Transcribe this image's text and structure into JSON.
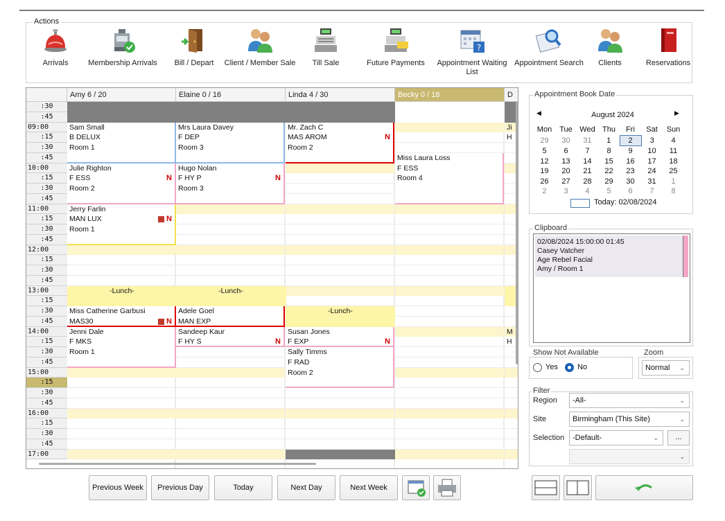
{
  "actions": {
    "legend": "Actions",
    "items": [
      {
        "label": "Arrivals",
        "icon": "bell-icon"
      },
      {
        "label": "Membership Arrivals",
        "icon": "membership-register-icon"
      },
      {
        "label": "Bill / Depart",
        "icon": "door-icon"
      },
      {
        "label": "Client / Member Sale",
        "icon": "clients-icon"
      },
      {
        "label": "Till Sale",
        "icon": "till-icon"
      },
      {
        "label": "Future Payments",
        "icon": "till-card-icon"
      },
      {
        "label": "Appointment Waiting\nList",
        "icon": "calendar-help-icon"
      },
      {
        "label": "Appointment Search",
        "icon": "calendar-search-icon"
      },
      {
        "label": "Clients",
        "icon": "clients-icon"
      },
      {
        "label": "Reservations",
        "icon": "book-icon"
      }
    ]
  },
  "grid": {
    "columns": [
      "Amy 6 / 20",
      "Elaine 0 / 16",
      "Linda 4 / 30",
      "Becky 0 / 18",
      "D"
    ],
    "times": [
      ":30",
      ":45",
      "09:00",
      ":15",
      ":30",
      ":45",
      "10:00",
      ":15",
      ":30",
      ":45",
      "11:00",
      ":15",
      ":30",
      ":45",
      "12:00",
      ":15",
      ":30",
      ":45",
      "13:00",
      ":15",
      ":30",
      ":45",
      "14:00",
      ":15",
      ":30",
      ":45",
      "15:00",
      ":15",
      ":30",
      ":45",
      "16:00",
      ":15",
      ":30",
      ":45",
      "17:00"
    ],
    "current_slot": ":15",
    "appointments": [
      {
        "lines": [
          "Sam Small",
          "B DELUX",
          "Room 1"
        ]
      },
      {
        "lines": [
          "Mrs Laura Davey",
          "F DEP",
          "Room 3"
        ]
      },
      {
        "lines": [
          "Mr. Zach C",
          "MAS AROM",
          "Room 2"
        ]
      },
      {
        "lines": [
          "Julie Righton",
          "F ESS",
          "Room 2"
        ]
      },
      {
        "lines": [
          "Hugo Nolan",
          "F HY P",
          "Room 3"
        ]
      },
      {
        "lines": [
          "Miss Laura Loss",
          "F ESS",
          "Room 4"
        ]
      },
      {
        "lines": [
          "Jerry Farlin",
          "MAN LUX",
          "Room 1"
        ]
      },
      {
        "lines": [
          "Miss Catherine Garbusi",
          "MAS30"
        ]
      },
      {
        "lines": [
          "Adele Goel",
          "MAN EXP"
        ]
      },
      {
        "lines": [
          "Jenni Dale",
          "F MKS",
          "Room 1"
        ]
      },
      {
        "lines": [
          "Sandeep Kaur",
          "F HY S"
        ]
      },
      {
        "lines": [
          "Susan Jones",
          "F EXP"
        ]
      },
      {
        "lines": [
          "Sally Timms",
          "F RAD",
          "Room 2"
        ]
      }
    ],
    "partial_right": [
      "Ji",
      "H",
      "M",
      "H"
    ],
    "lunch_label": "-Lunch-",
    "new_flag": "N"
  },
  "date_panel": {
    "legend": "Appointment Book Date",
    "month": "August 2024",
    "weekdays": [
      "Mon",
      "Tue",
      "Wed",
      "Thu",
      "Fri",
      "Sat",
      "Sun"
    ],
    "weeks": [
      [
        "29",
        "30",
        "31",
        "1",
        "2",
        "3",
        "4"
      ],
      [
        "5",
        "6",
        "7",
        "8",
        "9",
        "10",
        "11"
      ],
      [
        "12",
        "13",
        "14",
        "15",
        "16",
        "17",
        "18"
      ],
      [
        "19",
        "20",
        "21",
        "22",
        "23",
        "24",
        "25"
      ],
      [
        "26",
        "27",
        "28",
        "29",
        "30",
        "31",
        "1"
      ],
      [
        "2",
        "3",
        "4",
        "5",
        "6",
        "7",
        "8"
      ]
    ],
    "selected_day": "2",
    "today_label": "Today: 02/08/2024"
  },
  "clipboard": {
    "legend": "Clipboard",
    "lines": [
      "02/08/2024 15:00:00 01:45",
      "Casey Vatcher",
      "Age Rebel Facial",
      "Amy / Room 1"
    ]
  },
  "show_not_available": {
    "legend": "Show Not Available",
    "yes": "Yes",
    "no": "No",
    "selected": "No"
  },
  "zoom": {
    "legend": "Zoom",
    "value": "Normal"
  },
  "filter": {
    "legend": "Filter",
    "region_label": "Region",
    "region_value": "-All-",
    "site_label": "Site",
    "site_value": "Birmingham (This Site)",
    "selection_label": "Selection",
    "selection_value": "-Default-",
    "ellipsis": "..."
  },
  "bottom": {
    "previous_week": "Previous Week",
    "previous_day": "Previous Day",
    "today": "Today",
    "next_day": "Next Day",
    "next_week": "Next Week"
  },
  "colors": {
    "free_slot": "#fdf5cc",
    "unavailable": "#808080",
    "lunch": "#fdf5a8",
    "border_pink": "#f2a7c8",
    "border_blue": "#8fb6e8",
    "border_red": "#e00000",
    "border_yellow": "#f2e24a",
    "current_time": "#c8b870"
  }
}
